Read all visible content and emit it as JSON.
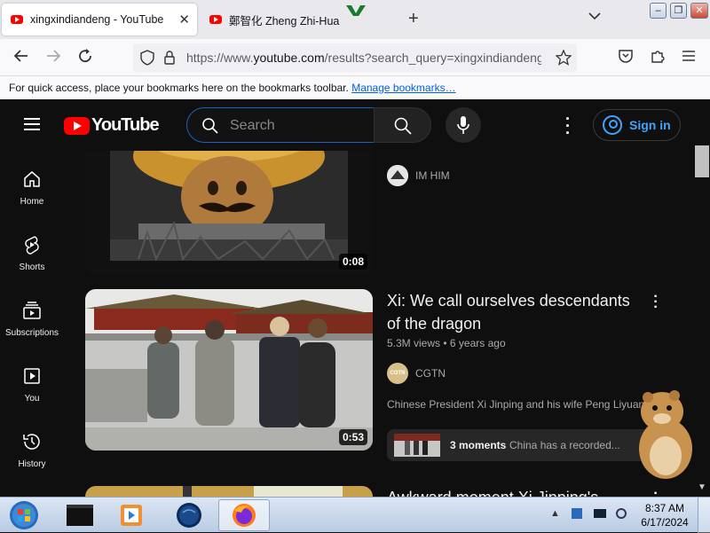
{
  "browser": {
    "tabs": [
      {
        "title": "xingxindiandeng - YouTube",
        "active": true
      },
      {
        "title": "鄭智化 Zheng Zhi-Hua",
        "active": false
      }
    ],
    "url_prefix": "https://www.",
    "url_domain": "youtube.com",
    "url_rest": "/results?search_query=xingxindiandeng",
    "bookmarks_text": "For quick access, place your bookmarks here on the bookmarks toolbar.",
    "bookmarks_link": "Manage bookmarks…"
  },
  "youtube": {
    "logo_text": "YouTube",
    "search_placeholder": "Search",
    "signin_label": "Sign in",
    "sidebar": [
      {
        "label": "Home",
        "icon": "home-icon"
      },
      {
        "label": "Shorts",
        "icon": "shorts-icon"
      },
      {
        "label": "Subscriptions",
        "icon": "subscriptions-icon"
      },
      {
        "label": "You",
        "icon": "you-icon"
      },
      {
        "label": "History",
        "icon": "history-icon"
      }
    ],
    "results": [
      {
        "duration": "0:08",
        "channel": "IM HIM"
      },
      {
        "title_line1": "Xi: We call ourselves descendants",
        "title_line2": "of the dragon",
        "views": "5.3M views",
        "age": "6 years ago",
        "channel": "CGTN",
        "channel_badge": "CGTN",
        "duration": "0:53",
        "description": "Chinese President Xi Jinping and his wife Peng Liyuan",
        "moments_label": "3 moments",
        "moments_text": "China has a recorded..."
      },
      {
        "title_partial": "Awkward moment Xi Jinping's"
      }
    ]
  },
  "taskbar": {
    "time": "8:37 AM",
    "date": "6/17/2024"
  },
  "colors": {
    "youtube_red": "#ff0000",
    "link_blue": "#3ea6ff",
    "search_focus": "#1c62b9",
    "background": "#0f0f0f"
  }
}
